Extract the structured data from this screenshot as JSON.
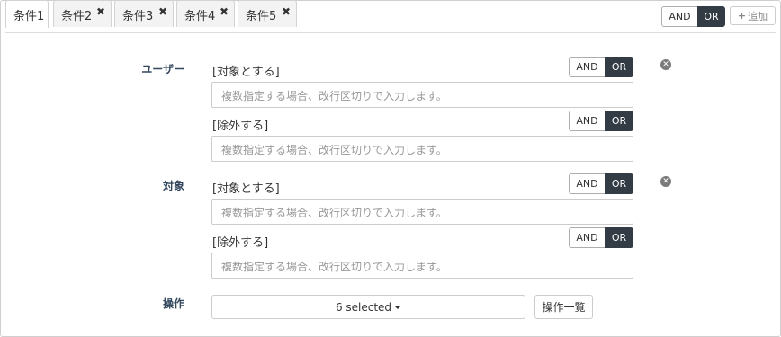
{
  "tabs": [
    {
      "label": "条件1",
      "closable": false,
      "active": true
    },
    {
      "label": "条件2",
      "closable": true
    },
    {
      "label": "条件3",
      "closable": true
    },
    {
      "label": "条件4",
      "closable": true
    },
    {
      "label": "条件5",
      "closable": true
    }
  ],
  "tab_close_glyph": "✖",
  "logic": {
    "and": "AND",
    "or": "OR",
    "selected": "OR"
  },
  "add_label": "追加",
  "sections": [
    {
      "label": "ユーザー",
      "include_label": "[対象とする]",
      "include_placeholder": "複数指定する場合、改行区切りで入力します。",
      "exclude_label": "[除外する]",
      "exclude_placeholder": "複数指定する場合、改行区切りで入力します。"
    },
    {
      "label": "対象",
      "include_label": "[対象とする]",
      "include_placeholder": "複数指定する場合、改行区切りで入力します。",
      "exclude_label": "[除外する]",
      "exclude_placeholder": "複数指定する場合、改行区切りで入力します。"
    }
  ],
  "operation": {
    "label": "操作",
    "selected_text": "6 selected",
    "list_button": "操作一覧"
  },
  "icons": {
    "remove": "remove-circle-icon",
    "add": "plus-icon",
    "close": "close-icon",
    "caret": "caret-down-icon"
  }
}
